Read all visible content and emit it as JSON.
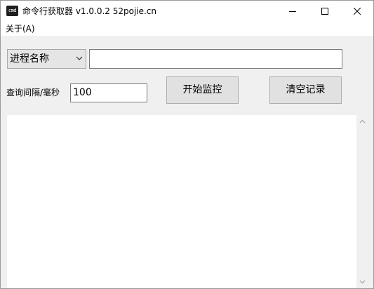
{
  "window": {
    "icon_text": "cmd",
    "title": "命令行获取器 v1.0.0.2    52pojie.cn"
  },
  "menu": {
    "about": "关于(A)"
  },
  "controls": {
    "combo_selected": "进程名称",
    "main_text_value": "",
    "interval_label": "查询间隔/毫秒",
    "interval_value": "100",
    "start_button": "开始监控",
    "clear_button": "清空记录"
  },
  "log": {
    "content": ""
  },
  "icons": {
    "app": "cmd-icon",
    "minimize": "minimize-icon",
    "maximize": "maximize-icon",
    "close": "close-icon",
    "combo_arrow": "chevron-down-icon",
    "scroll_up": "scroll-up-arrow-icon",
    "scroll_down": "scroll-down-arrow-icon"
  }
}
